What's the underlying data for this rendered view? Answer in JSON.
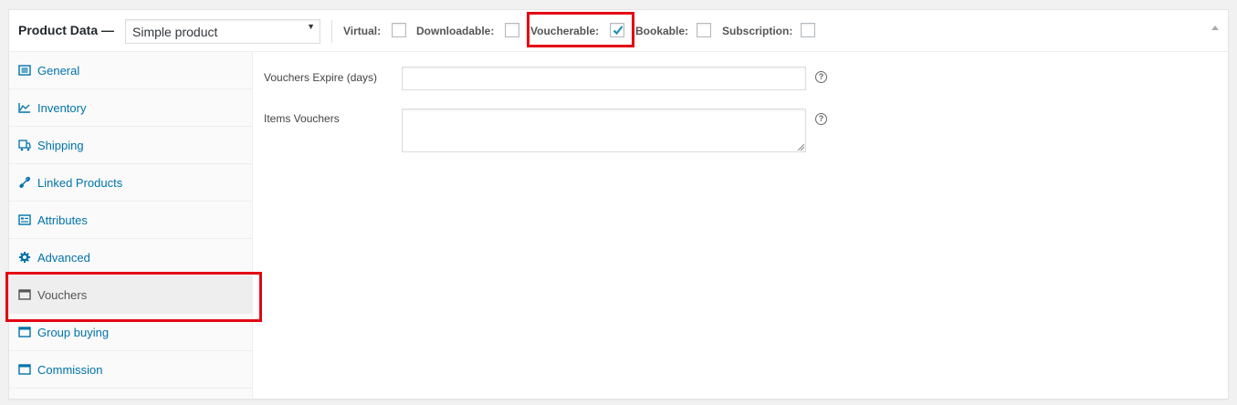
{
  "header": {
    "title": "Product Data —",
    "product_type": "Simple product",
    "options": [
      {
        "label": "Virtual:",
        "checked": false
      },
      {
        "label": "Downloadable:",
        "checked": false
      },
      {
        "label": "Voucherable:",
        "checked": true
      },
      {
        "label": "Bookable:",
        "checked": false
      },
      {
        "label": "Subscription:",
        "checked": false
      }
    ]
  },
  "tabs": [
    {
      "label": "General",
      "icon": "general-icon"
    },
    {
      "label": "Inventory",
      "icon": "inventory-icon"
    },
    {
      "label": "Shipping",
      "icon": "truck-icon"
    },
    {
      "label": "Linked Products",
      "icon": "link-icon"
    },
    {
      "label": "Attributes",
      "icon": "attributes-icon"
    },
    {
      "label": "Advanced",
      "icon": "gear-icon"
    },
    {
      "label": "Vouchers",
      "icon": "window-icon",
      "active": true
    },
    {
      "label": "Group buying",
      "icon": "window-icon"
    },
    {
      "label": "Commission",
      "icon": "window-icon"
    }
  ],
  "fields": {
    "vouchers_expire": {
      "label": "Vouchers Expire (days)",
      "value": ""
    },
    "items_vouchers": {
      "label": "Items Vouchers",
      "value": ""
    },
    "help_glyph": "?"
  },
  "colors": {
    "link": "#0073aa",
    "highlight": "#e30613",
    "check": "#1e8cbe"
  }
}
